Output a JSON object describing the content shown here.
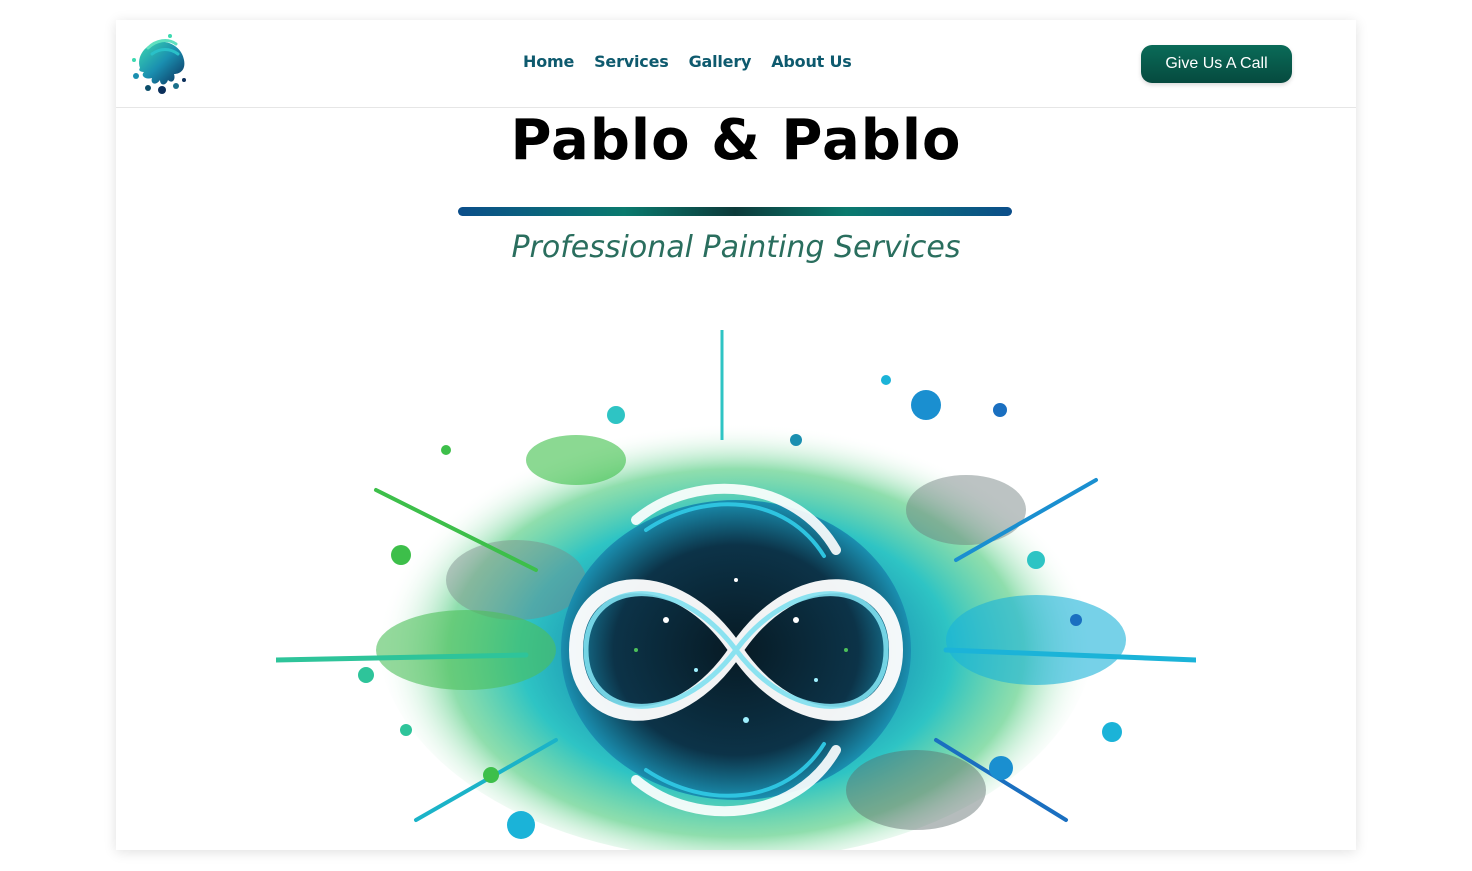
{
  "nav": {
    "items": [
      {
        "label": "Home"
      },
      {
        "label": "Services"
      },
      {
        "label": "Gallery"
      },
      {
        "label": "About Us"
      }
    ],
    "cta_label": "Give Us A Call"
  },
  "hero": {
    "title": "Pablo & Pablo",
    "subtitle": "Professional Painting Services",
    "image_icon": "paint-splash-infinity-icon"
  },
  "logo": {
    "icon": "paint-splash-logo-icon"
  },
  "colors": {
    "nav_text": "#0e5a6e",
    "cta_bg": "#064a3f",
    "subtitle": "#2a6e5e",
    "teal": "#1bb3c8",
    "green": "#3dbf4a",
    "blue": "#1a6fc0"
  }
}
